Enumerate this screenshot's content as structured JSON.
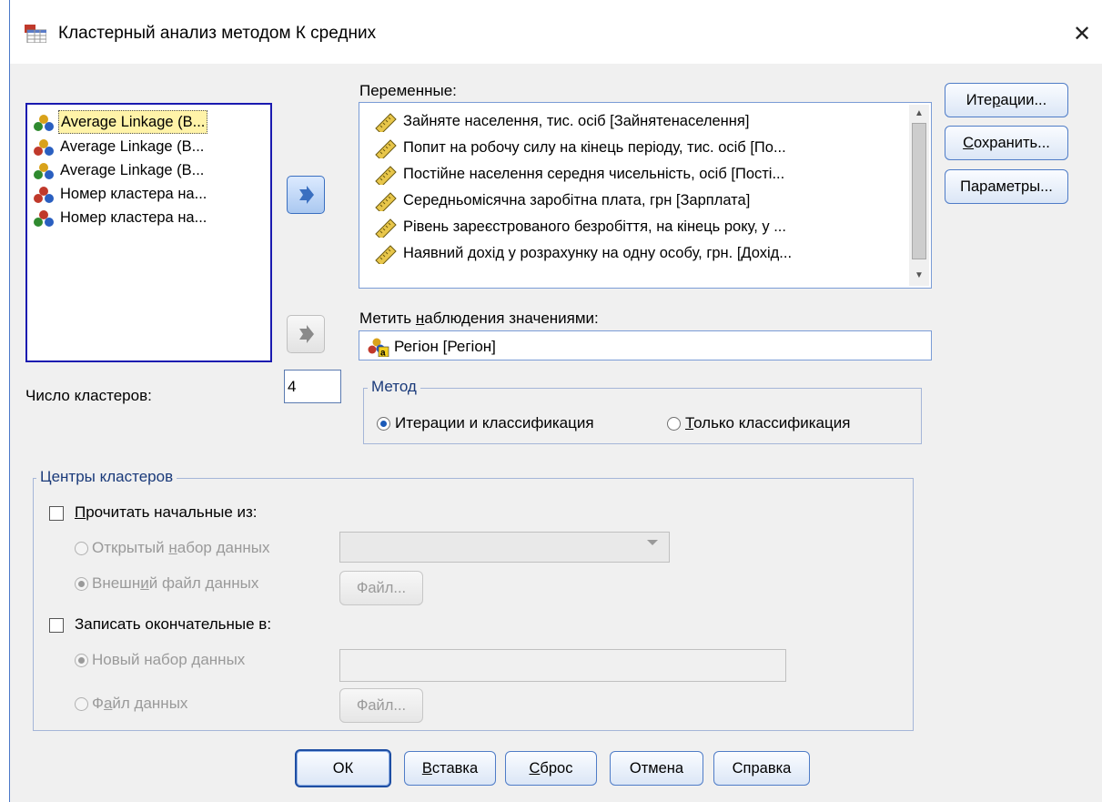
{
  "window": {
    "title": "Кластерный анализ методом К средних",
    "close_glyph": "✕"
  },
  "source_list": {
    "items": [
      {
        "label": "Average Linkage (B...",
        "icon": "nominal-variable-icon",
        "selected": true
      },
      {
        "label": "Average Linkage (B...",
        "icon": "nominal-variable-icon",
        "selected": false
      },
      {
        "label": "Average Linkage (B...",
        "icon": "nominal-variable-icon",
        "selected": false
      },
      {
        "label": "Номер кластера на...",
        "icon": "nominal-variable-icon",
        "selected": false
      },
      {
        "label": "Номер кластера на...",
        "icon": "nominal-variable-icon",
        "selected": false
      }
    ]
  },
  "variables": {
    "label": "Переменные:",
    "items": [
      "Зайняте населення, тис. осіб [Зайнятенаселення]",
      "Попит на робочу силу на кінець періоду, тис. осіб [По...",
      "Постійне населення середня чисельність, осіб [Пості...",
      "Середньомісячна заробітна плата, грн [Зарплата]",
      "Рівень зареєстрованого безробіття, на кінець року, у ...",
      "Наявний дохід у розрахунку на одну особу, грн. [Дохід..."
    ]
  },
  "label_cases": {
    "label_pre": "Метить ",
    "label_ul": "н",
    "label_post": "аблюдения значениями:",
    "value": "Регіон [Регіон]"
  },
  "num_clusters": {
    "label": "Число кластеров:",
    "value": "4"
  },
  "method": {
    "legend": "Метод",
    "option1": "Итерации и классификация",
    "option2_ul": "Т",
    "option2_rest": "олько классификация",
    "selected": "option1"
  },
  "centers": {
    "legend": "Центры кластеров",
    "read_pre": "",
    "read_ul": "П",
    "read_rest": "рочитать начальные из:",
    "open_dataset_pre": "Открытый ",
    "open_dataset_ul": "н",
    "open_dataset_rest": "абор данных",
    "external_file_pre": "Внешн",
    "external_file_ul": "и",
    "external_file_rest": "й файл данных",
    "file_button_1": "Файл...",
    "write_label": "Записать окончательные в:",
    "new_dataset": "Новый набор данных",
    "data_file_pre": "Ф",
    "data_file_ul": "а",
    "data_file_rest": "йл данных",
    "file_button_2": "Файл..."
  },
  "side_buttons": {
    "iterations_pre": "Ите",
    "iterations_ul": "р",
    "iterations_rest": "ации...",
    "save_ul": "С",
    "save_rest": "охранить...",
    "options": "Параметры..."
  },
  "bottom_buttons": {
    "ok": "ОК",
    "paste_ul": "В",
    "paste_rest": "ставка",
    "reset_ul": "С",
    "reset_rest": "брос",
    "cancel": "Отмена",
    "help": "Справка"
  },
  "colors": {
    "accent": "#1a5ab8",
    "selection": "#fff3a8",
    "list_border": "#1a1ab0"
  }
}
